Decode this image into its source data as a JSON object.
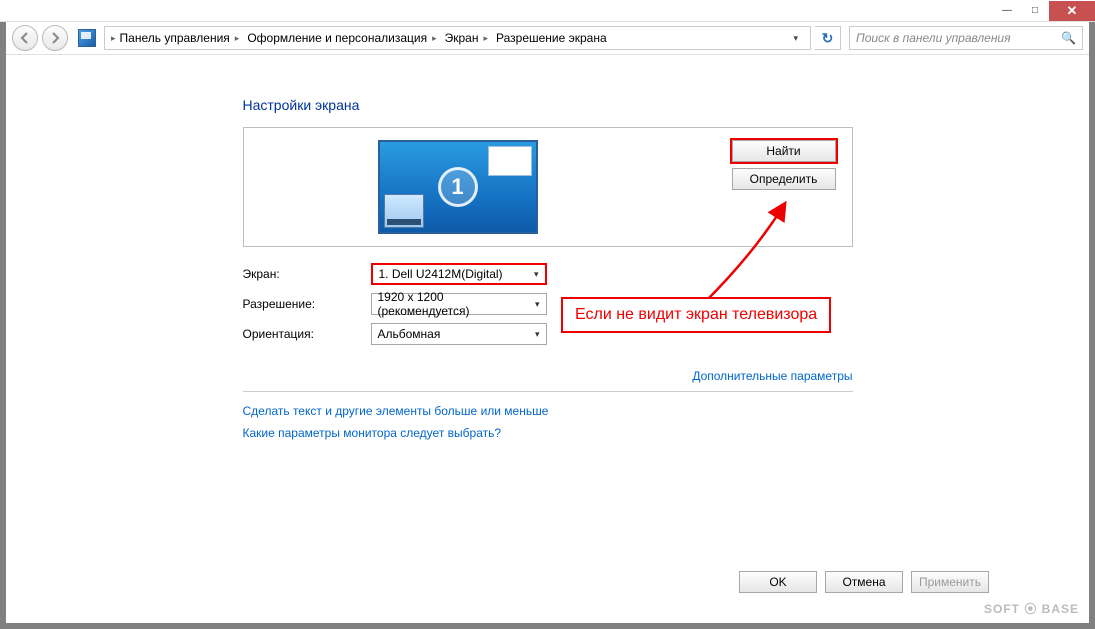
{
  "titlebar": {
    "min": "—",
    "max": "□",
    "close": "✕"
  },
  "breadcrumb": {
    "seg1": "Панель управления",
    "seg2": "Оформление и персонализация",
    "seg3": "Экран",
    "seg4": "Разрешение экрана"
  },
  "search": {
    "placeholder": "Поиск в панели управления"
  },
  "page": {
    "title": "Настройки экрана",
    "monitor_number": "1",
    "detect_btn": "Найти",
    "identify_btn": "Определить"
  },
  "form": {
    "display_label": "Экран:",
    "display_value": "1. Dell U2412M(Digital)",
    "resolution_label": "Разрешение:",
    "resolution_value": "1920 x 1200 (рекомендуется)",
    "orientation_label": "Ориентация:",
    "orientation_value": "Альбомная"
  },
  "links": {
    "advanced": "Дополнительные параметры",
    "textsize": "Сделать текст и другие элементы больше или меньше",
    "whichparams": "Какие параметры монитора следует выбрать?"
  },
  "dlg": {
    "ok": "OK",
    "cancel": "Отмена",
    "apply": "Применить"
  },
  "annotation": "Если не видит экран телевизора",
  "watermark": "SOFT ⦿ BASE"
}
